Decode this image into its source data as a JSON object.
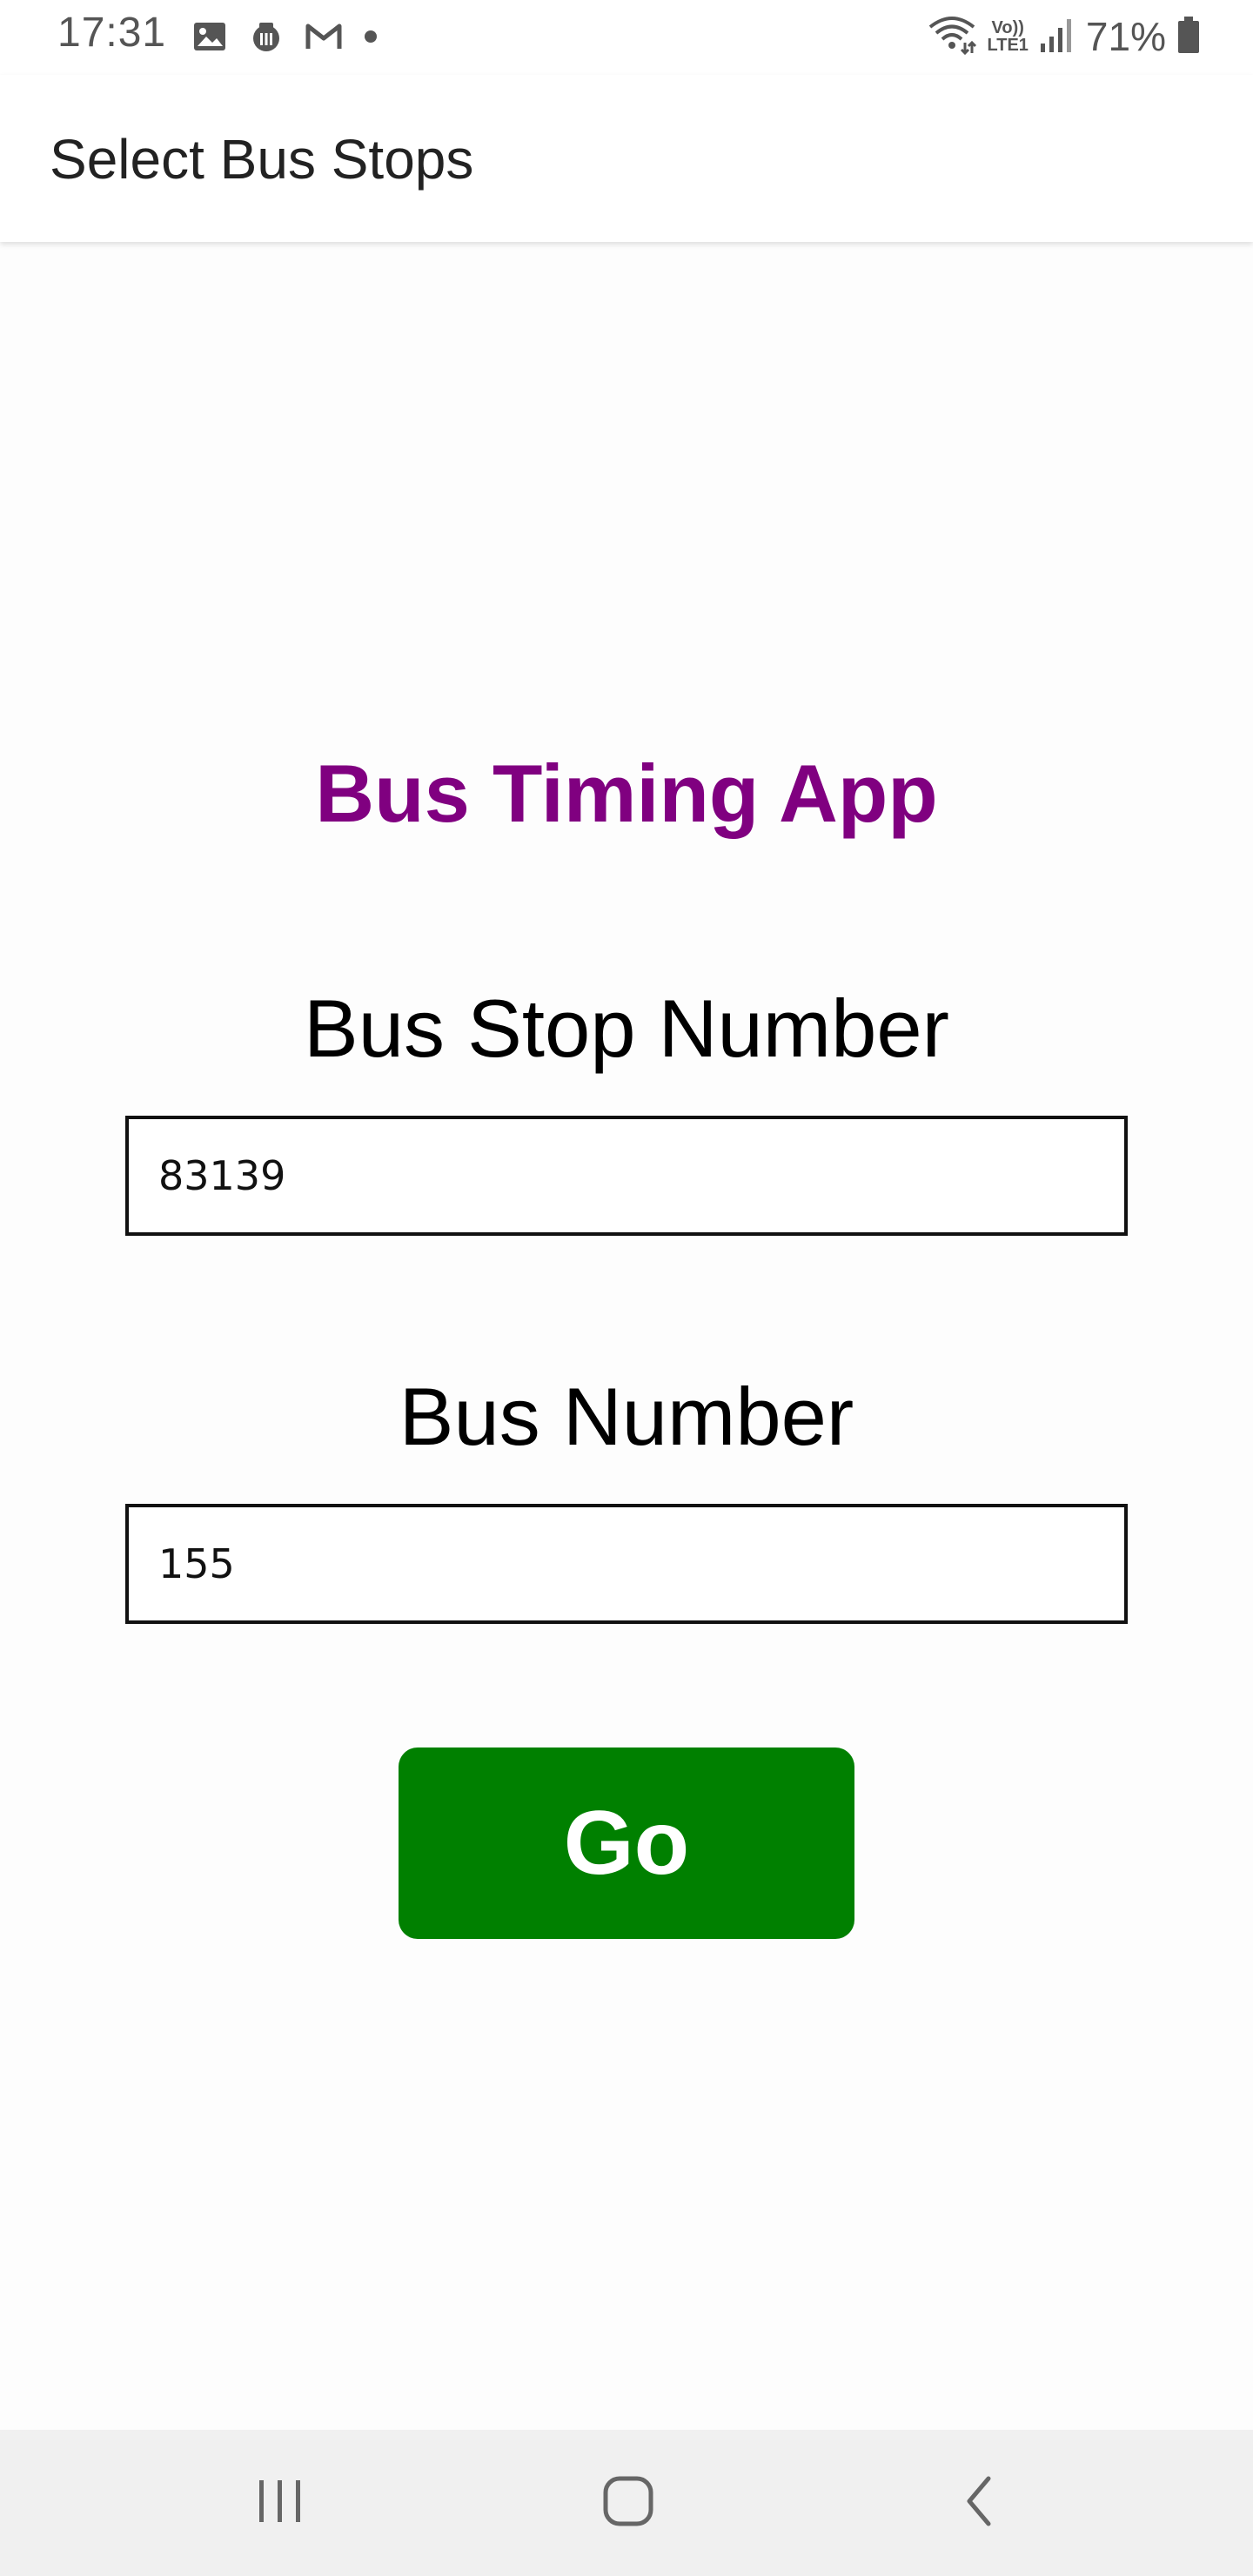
{
  "status_bar": {
    "time": "17:31",
    "left_icons": [
      "image-icon",
      "app-notification-icon",
      "gmail-icon",
      "dot-icon"
    ],
    "right_icons": [
      "wifi-icon",
      "volte-lte-icon",
      "signal-icon",
      "battery-icon"
    ],
    "volte_text": "Vo))",
    "lte_text": "LTE1",
    "battery": "71%"
  },
  "app_bar": {
    "title": "Select Bus Stops"
  },
  "main": {
    "app_title": "Bus Timing App",
    "bus_stop_label": "Bus Stop Number",
    "bus_stop_value": "83139",
    "bus_number_label": "Bus Number",
    "bus_number_value": "155",
    "go_label": "Go"
  },
  "nav_bar": {
    "buttons": [
      "recent-apps-icon",
      "home-icon",
      "back-icon"
    ]
  },
  "colors": {
    "title_purple": "#800080",
    "button_green": "#008000",
    "nav_bg": "#f0f0f0"
  }
}
